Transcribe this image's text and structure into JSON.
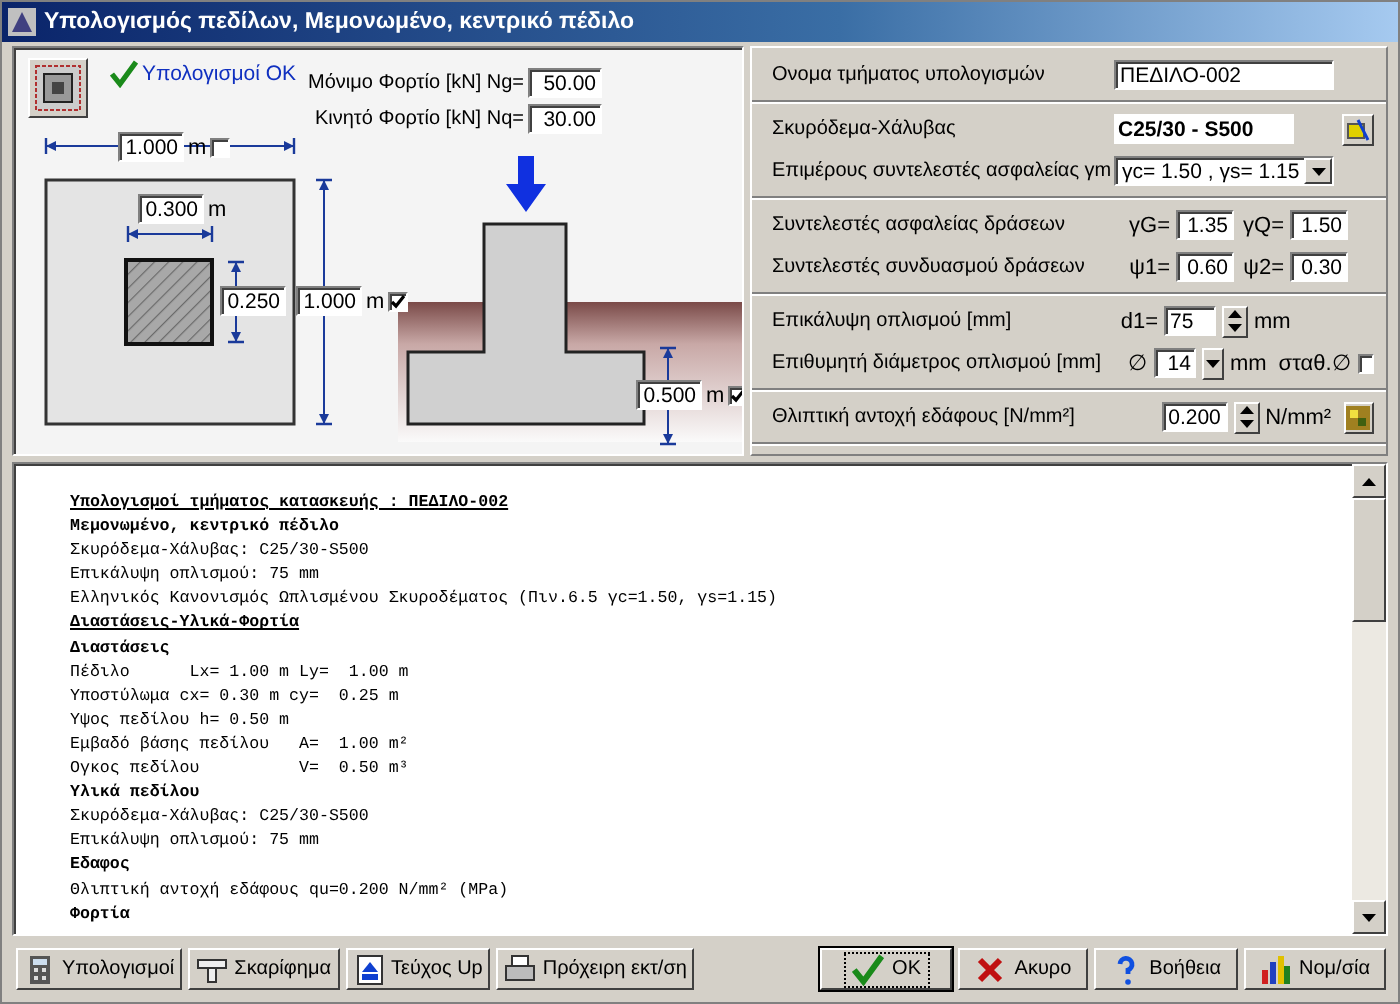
{
  "window": {
    "title": "Υπολογισμός πεδίλων, Μεμονωμένο, κεντρικό πέδιλο"
  },
  "status": {
    "text": "Υπολογισμοί OK",
    "ok": true
  },
  "loads": [
    {
      "label": "Μόνιμο Φορτίο [kN] Ng=",
      "value": "50.00"
    },
    {
      "label": "Κινητό Φορτίο [kN] Nq=",
      "value": "30.00"
    }
  ],
  "dimensions": {
    "footing_width": {
      "value": "1.000",
      "unit": "m",
      "checked": false
    },
    "column_width": {
      "value": "0.300",
      "unit": "m"
    },
    "column_depth": {
      "value": "0.250"
    },
    "footing_length": {
      "value": "1.000",
      "unit": "m",
      "checked": true
    },
    "footing_height": {
      "value": "0.500",
      "unit": "m",
      "checked": true
    }
  },
  "form": [
    [
      {
        "kind": "text",
        "label": "Ονομα τμήματος υπολογισμών",
        "value": "ΠΕΔΙΛΟ-002"
      }
    ],
    [
      {
        "kind": "material",
        "label": "Σκυρόδεμα-Χάλυβας",
        "value": "C25/30 - S500"
      },
      {
        "kind": "select",
        "label": "Επιμέρους συντελεστές ασφαλείας γm",
        "value": "γc= 1.50 , γs= 1.15"
      }
    ],
    [
      {
        "kind": "pair",
        "label": "Συντελεστές ασφαλείας δράσεων",
        "fields": [
          {
            "prefix": "γG=",
            "value": "1.35"
          },
          {
            "prefix": "γQ=",
            "value": "1.50"
          }
        ]
      },
      {
        "kind": "pair",
        "label": "Συντελεστές συνδυασμού δράσεων",
        "fields": [
          {
            "prefix": "ψ1=",
            "value": "0.60"
          },
          {
            "prefix": "ψ2=",
            "value": "0.30"
          }
        ]
      }
    ],
    [
      {
        "kind": "spin",
        "label": "Επικάλυψη οπλισμού [mm]",
        "prefix": "d1=",
        "value": "75",
        "unit": "mm"
      },
      {
        "kind": "dropdown",
        "label": "Επιθυμητή διάμετρος οπλισμού [mm]",
        "prefix": "∅",
        "value": "14",
        "unit": "mm",
        "option": {
          "label": "σταθ.∅",
          "checked": false
        }
      }
    ],
    [
      {
        "kind": "spin",
        "label": "Θλιπτική αντοχή εδάφους [N/mm²]",
        "value": "0.200",
        "unit": "N/mm²",
        "button": true
      }
    ]
  ],
  "report": [
    {
      "kind": "title",
      "text": "Υπολογισμοί τμήματος κατασκευής : ΠΕΔΙΛΟ-002"
    },
    {
      "kind": "bold",
      "text": "Μεμονωμένο, κεντρικό πέδιλο"
    },
    {
      "kind": "plain",
      "text": "Σκυρόδεμα-Χάλυβας: C25/30-S500"
    },
    {
      "kind": "plain",
      "text": "Επικάλυψη οπλισμού: 75 mm"
    },
    {
      "kind": "plain",
      "text": "Ελληνικός Κανονισμός Ωπλισμένου Σκυροδέματος (Πιν.6.5 γc=1.50, γs=1.15)"
    },
    {
      "kind": "title",
      "text": "Διαστάσεις-Υλικά-Φορτία"
    },
    {
      "kind": "bold",
      "text": "Διαστάσεις"
    },
    {
      "kind": "plain",
      "text": "Πέδιλο      Lx= 1.00 m Ly=  1.00 m"
    },
    {
      "kind": "plain",
      "text": "Υποστύλωμα cx= 0.30 m cy=  0.25 m"
    },
    {
      "kind": "plain",
      "text": "Υψος πεδίλου h= 0.50 m"
    },
    {
      "kind": "plain",
      "text": "Εμβαδό βάσης πεδίλου   A=  1.00 m²"
    },
    {
      "kind": "plain",
      "text": "Ογκος πεδίλου          V=  0.50 m³"
    },
    {
      "kind": "bold",
      "text": "Υλικά πεδίλου"
    },
    {
      "kind": "plain",
      "text": "Σκυρόδεμα-Χάλυβας: C25/30-S500"
    },
    {
      "kind": "plain",
      "text": "Επικάλυψη οπλισμού: 75 mm"
    },
    {
      "kind": "bold",
      "text": "Εδαφος"
    },
    {
      "kind": "plain",
      "text": "Θλιπτική αντοχή εδάφους qu=0.200 N/mm² (MPa)"
    },
    {
      "kind": "bold",
      "text": "Φορτία"
    }
  ],
  "buttons_left": [
    {
      "kind": "calculator",
      "label": "Υπολογισμοί"
    },
    {
      "kind": "stamp",
      "label": "Σκαρίφημα"
    },
    {
      "kind": "document",
      "label": "Τεύχος Up"
    },
    {
      "kind": "printer",
      "label": "Πρόχειρη εκτ/ση"
    }
  ],
  "buttons_right": [
    {
      "kind": "check",
      "label": "OK",
      "default": true
    },
    {
      "kind": "cross",
      "label": "Ακυρο",
      "default": false
    },
    {
      "kind": "help",
      "label": "Βοήθεια",
      "default": false
    },
    {
      "kind": "chart",
      "label": "Νομ/σία",
      "default": false
    }
  ]
}
